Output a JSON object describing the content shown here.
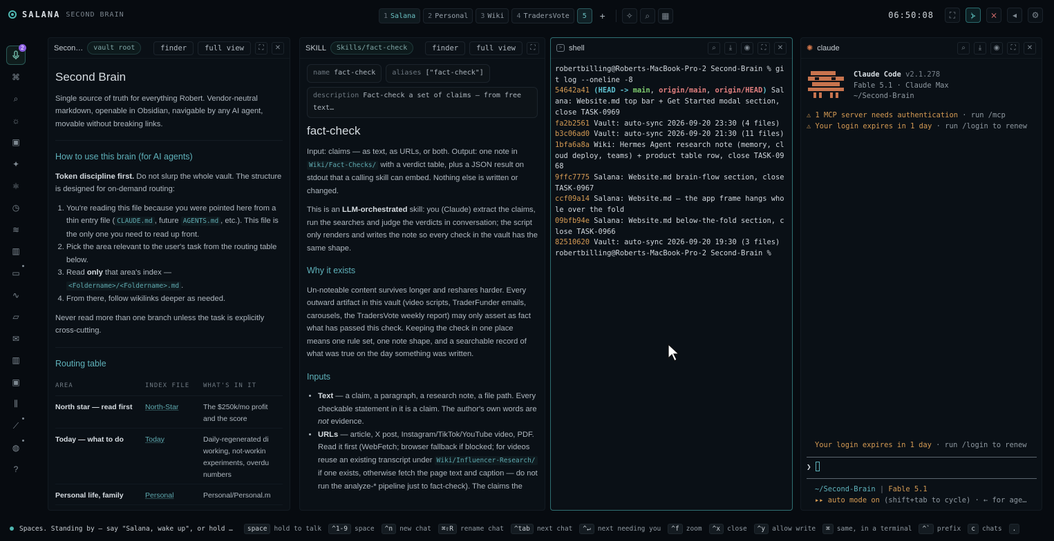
{
  "brand": {
    "name": "SALANA",
    "subtitle": "SECOND BRAIN"
  },
  "spaces": [
    {
      "num": "1",
      "label": "Salana"
    },
    {
      "num": "2",
      "label": "Personal"
    },
    {
      "num": "3",
      "label": "Wiki"
    },
    {
      "num": "4",
      "label": "TradersVote"
    }
  ],
  "current_space": "5",
  "clock": "06:50:08",
  "sidebar": {
    "badge": "2"
  },
  "pane1": {
    "title": "Secon…",
    "chip": "vault root",
    "finder": "finder",
    "full_view": "full view",
    "h1": "Second Brain",
    "intro": "Single source of truth for everything Robert. Vendor-neutral markdown, openable in Obsidian, navigable by any AI agent, movable without breaking links.",
    "h2_how": "How to use this brain (for AI agents)",
    "token_bold": "Token discipline first.",
    "token_rest": " Do not slurp the whole vault. The structure is designed for on-demand routing:",
    "li1_a": "You're reading this file because you were pointed here from a thin entry file (",
    "li1_code1": "CLAUDE.md",
    "li1_b": ", future ",
    "li1_code2": "AGENTS.md",
    "li1_c": ", etc.). This file is the only one you need to read up front.",
    "li2": "Pick the area relevant to the user's task from the routing table below.",
    "li3_a": "Read ",
    "li3_bold": "only",
    "li3_b": " that area's index —",
    "li3_code": "<Foldername>/<Foldername>.md",
    "li3_c": ".",
    "li4": "From there, follow wikilinks deeper as needed.",
    "never": "Never read more than one branch unless the task is explicitly cross-cutting.",
    "h2_routing": "Routing table",
    "table_headers": [
      "AREA",
      "INDEX FILE",
      "WHAT'S IN IT"
    ],
    "rows": [
      {
        "area": "North star — read first",
        "index": "North-Star",
        "what": "The $250k/mo profit and the score"
      },
      {
        "area": "Today — what to do",
        "index": "Today",
        "what": "Daily-regenerated di working, not-workin experiments, overdu numbers"
      },
      {
        "area": "Personal life, family",
        "index": "Personal",
        "what": "Personal/Personal.m"
      }
    ]
  },
  "pane2": {
    "title": "SKILL",
    "chip": "Skills/fact-check",
    "finder": "finder",
    "full_view": "full view",
    "prop_name_key": "name",
    "prop_name_val": "fact-check",
    "prop_alias_key": "aliases",
    "prop_alias_val": "[\"fact-check\"]",
    "prop_desc_key": "description",
    "prop_desc_val": "Fact-check a set of claims — from free text…",
    "h1": "fact-check",
    "p1_a": "Input: claims — as text, as URLs, or both. Output: one note in ",
    "p1_code": "Wiki/Fact-Checks/",
    "p1_b": " with a verdict table, plus a JSON result on stdout that a calling skill can embed. Nothing else is written or changed.",
    "p2_a": "This is an ",
    "p2_bold": "LLM-orchestrated",
    "p2_b": " skill: you (Claude) extract the claims, run the searches and judge the verdicts in conversation; the script only renders and writes the note so every check in the vault has the same shape.",
    "h2_why": "Why it exists",
    "why": "Un-noteable content survives longer and reshares harder. Every outward artifact in this vault (video scripts, TraderFunder emails, carousels, the TradersVote weekly report) may only assert as fact what has passed this check. Keeping the check in one place means one rule set, one note shape, and a searchable record of what was true on the day something was written.",
    "h2_inputs": "Inputs",
    "in1_bold": "Text",
    "in1_a": " — a claim, a paragraph, a research note, a file path. Every checkable statement in it is a claim. The author's own words are ",
    "in1_em": "not",
    "in1_b": " evidence.",
    "in2_bold": "URLs",
    "in2_a": " — article, X post, Instagram/TikTok/YouTube video, PDF. Read it first (WebFetch; browser fallback if blocked; for videos reuse an existing transcript under ",
    "in2_code": "Wiki/Influencer-Research/",
    "in2_b": " if one exists, otherwise fetch the page text and caption — do not run the analyze-* pipeline just to fact-check). The claims the"
  },
  "pane3": {
    "title": "shell",
    "prompt": "robertbilling@Roberts-MacBook-Pro-2 Second-Brain %",
    "cmd": " git log --oneline -8",
    "lines": [
      {
        "hash": "54642a41",
        "refs": true,
        "msg": " Salana: Website.md top bar + Get Started modal section, close TASK-0969"
      },
      {
        "hash": "fa2b2561",
        "msg": " Vault: auto-sync 2026-09-20 23:30 (4 files)"
      },
      {
        "hash": "b3c06ad0",
        "msg": " Vault: auto-sync 2026-09-20 21:30 (11 files)"
      },
      {
        "hash": "1bfa6a8a",
        "msg": " Wiki: Hermes Agent research note (memory, cloud deploy, teams) + product table row, close TASK-0968"
      },
      {
        "hash": "9ffc7775",
        "msg": " Salana: Website.md brain-flow section, close TASK-0967"
      },
      {
        "hash": "ccf09a14",
        "msg": " Salana: Website.md — the app frame hangs whole over the fold"
      },
      {
        "hash": "09bfb94e",
        "msg": " Salana: Website.md below-the-fold section, close TASK-0966"
      },
      {
        "hash": "82510620",
        "msg": " Vault: auto-sync 2026-09-20 19:30 (3 files)"
      }
    ],
    "refs": {
      "open": " (",
      "head": "HEAD -> ",
      "main": "main",
      "sep1": ", ",
      "origin_main": "origin/main",
      "sep2": ", ",
      "origin_head": "origin/HEAD",
      "close": ")"
    },
    "final_prompt": "robertbilling@Roberts-MacBook-Pro-2 Second-Brain %"
  },
  "pane4": {
    "title": "claude",
    "app": "Claude Code",
    "version": "v2.1.278",
    "model": "Fable 5.1 · Claude Max",
    "path": "~/Second-Brain",
    "warn1_a": "⚠ 1 MCP server needs authentication",
    "warn1_b": " · run /mcp",
    "warn2_a": "⚠ Your login expires in 1 day",
    "warn2_b": " · run /login to renew",
    "bottom_warn_a": "Your login expires in 1 day",
    "bottom_warn_b": " · run /login to renew",
    "input_prompt": "❯",
    "status_path": "~/Second-Brain",
    "status_sep": " | ",
    "status_model": "Fable 5.1",
    "auto_a": "▸▸ auto mode on",
    "auto_b": " (shift+tab to cycle) · ← for age…"
  },
  "bottombar": {
    "status": "Spaces. Standing by — say \"Salana, wake up\", or hold …",
    "hints": [
      {
        "key": "space",
        "text": "hold to talk"
      },
      {
        "key": "^1-9",
        "text": "space"
      },
      {
        "key": "^n",
        "text": "new chat"
      },
      {
        "key": "⌘⇧R",
        "text": "rename chat"
      },
      {
        "key": "^tab",
        "text": "next chat"
      },
      {
        "key": "^↵",
        "text": "next needing you"
      },
      {
        "key": "^f",
        "text": "zoom"
      },
      {
        "key": "^x",
        "text": "close"
      },
      {
        "key": "^y",
        "text": "allow write"
      },
      {
        "key": "⌘",
        "text": "same, in a terminal"
      },
      {
        "key": "^`",
        "text": "prefix"
      },
      {
        "key": "c",
        "text": "chats"
      },
      {
        "key": ".",
        "text": ""
      }
    ]
  },
  "colors": {
    "accent": "#4fb6b0",
    "link": "#5faab0",
    "hash": "#d49a53",
    "warn": "#d49a53",
    "badge": "#8a5ce0"
  }
}
